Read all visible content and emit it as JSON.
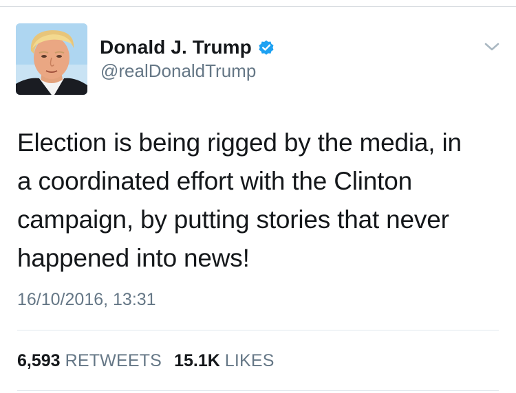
{
  "user": {
    "display_name": "Donald J. Trump",
    "handle": "@realDonaldTrump",
    "verified": true
  },
  "tweet": {
    "text": "Election is being rigged by the media, in\na coordinated effort with the Clinton\ncampaign, by putting stories that never\nhappened into news!",
    "timestamp": "16/10/2016, 13:31"
  },
  "stats": {
    "retweets_count": "6,593",
    "retweets_label": "RETWEETS",
    "likes_count": "15.1K",
    "likes_label": "LIKES"
  },
  "icons": {
    "verified": "verified-badge-icon",
    "menu": "chevron-down-icon"
  },
  "colors": {
    "primary_text": "#14171a",
    "secondary_text": "#657786",
    "verified_blue": "#1da1f2",
    "divider": "#e1e8ed"
  }
}
